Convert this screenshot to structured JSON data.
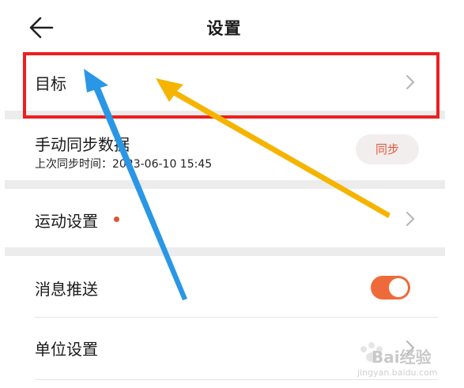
{
  "header": {
    "title": "设置"
  },
  "settings": {
    "goal": {
      "label": "目标"
    },
    "manual_sync": {
      "label": "手动同步数据",
      "last_sync": "上次同步时间：2023-06-10 15:45",
      "button": "同步"
    },
    "sport": {
      "label": "运动设置"
    },
    "push": {
      "label": "消息推送",
      "enabled": true
    },
    "units": {
      "label": "单位设置"
    }
  },
  "watermark": {
    "brand": "Bai经验",
    "url": "jingyan.baidu.com"
  },
  "colors": {
    "accent": "#ef6a3a",
    "highlight": "#ee1f1f",
    "arrow_blue": "#2a96e6",
    "arrow_yellow": "#f5b400"
  },
  "icons": {
    "back": "arrow-left-icon",
    "chevron": "chevron-right-icon"
  }
}
